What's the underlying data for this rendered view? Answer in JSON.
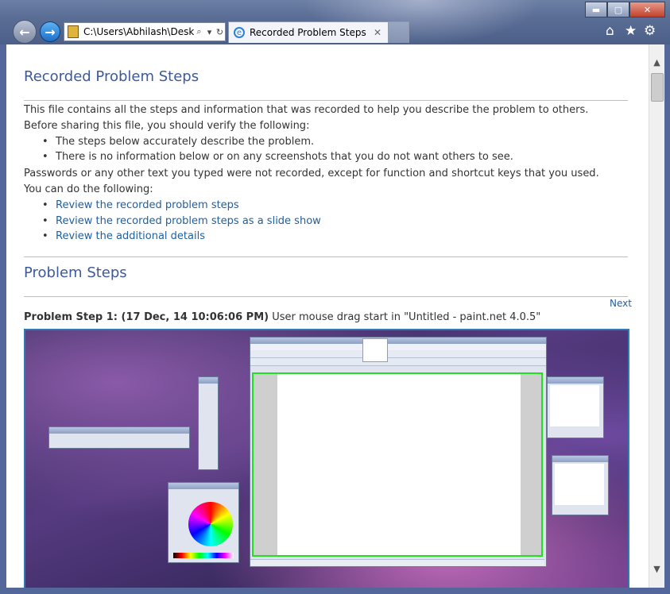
{
  "browser": {
    "address": "C:\\Users\\Abhilash\\Desk",
    "tab_title": "Recorded Problem Steps",
    "tab_close": "✕",
    "back": "←",
    "forward": "→",
    "search_glyph": "⌕",
    "dropdown_glyph": "▾",
    "refresh_glyph": "↻",
    "home_glyph": "⌂",
    "favorites_glyph": "★",
    "settings_glyph": "⚙",
    "min_glyph": "▬",
    "max_glyph": "▢",
    "close_glyph": "✕"
  },
  "scrollbar": {
    "up": "▲",
    "down": "▼"
  },
  "page": {
    "title": "Recorded Problem Steps",
    "intro": "This file contains all the steps and information that was recorded to help you describe the problem to others.",
    "verify_lead": "Before sharing this file, you should verify the following:",
    "verify_items": [
      "The steps below accurately describe the problem.",
      "There is no information below or on any screenshots that you do not want others to see."
    ],
    "passwords_note": "Passwords or any other text you typed were not recorded, except for function and shortcut keys that you used.",
    "do_lead": "You can do the following:",
    "links": [
      "Review the recorded problem steps",
      "Review the recorded problem steps as a slide show",
      "Review the additional details"
    ],
    "section_title": "Problem Steps",
    "next": "Next",
    "step_label": "Problem Step 1: (17 Dec, 14 10:06:06 PM)",
    "step_text": " User mouse drag start in \"Untitled - paint.net 4.0.5\""
  },
  "colors": {
    "heading": "#3c5a9a",
    "link": "#1f5fa0",
    "highlight": "#20e020",
    "frame": "#53679a"
  }
}
